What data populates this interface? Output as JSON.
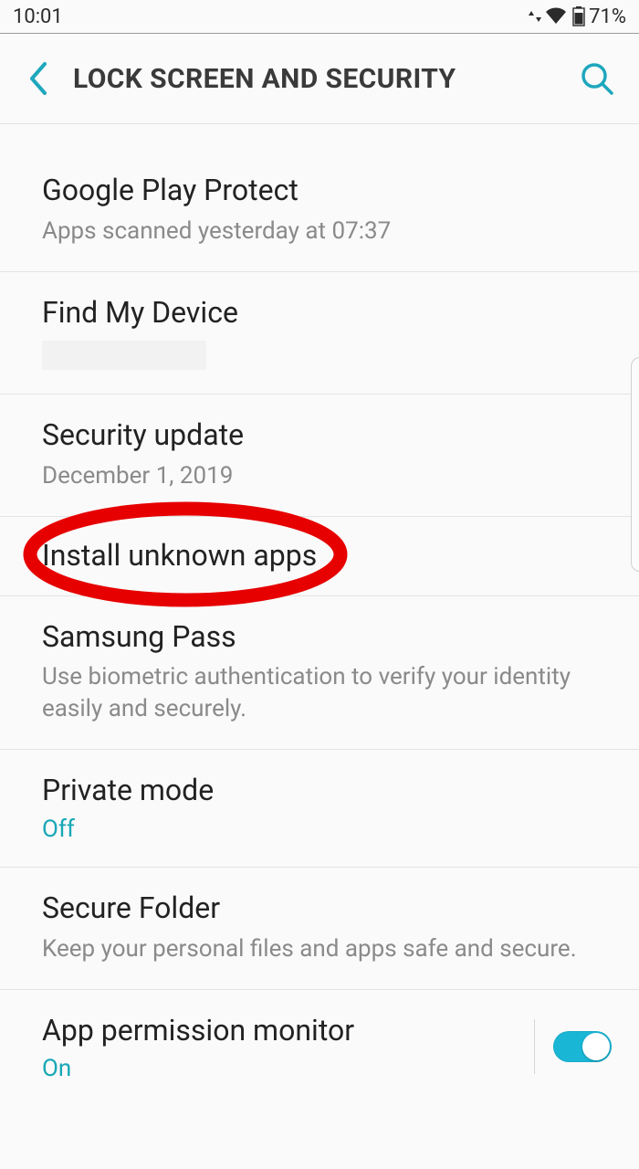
{
  "status": {
    "time": "10:01",
    "battery_text": "71%"
  },
  "header": {
    "title": "LOCK SCREEN AND SECURITY"
  },
  "items": {
    "google_play_protect": {
      "title": "Google Play Protect",
      "sub": "Apps scanned yesterday at 07:37"
    },
    "find_my_device": {
      "title": "Find My Device"
    },
    "security_update": {
      "title": "Security update",
      "sub": "December 1, 2019"
    },
    "install_unknown_apps": {
      "title": "Install unknown apps"
    },
    "samsung_pass": {
      "title": "Samsung Pass",
      "sub": "Use biometric authentication to verify your identity easily and securely."
    },
    "private_mode": {
      "title": "Private mode",
      "value": "Off"
    },
    "secure_folder": {
      "title": "Secure Folder",
      "sub": "Keep your personal files and apps safe and secure."
    },
    "app_permission_monitor": {
      "title": "App permission monitor",
      "value": "On"
    }
  },
  "annotation": {
    "highlighted_item": "install_unknown_apps"
  }
}
